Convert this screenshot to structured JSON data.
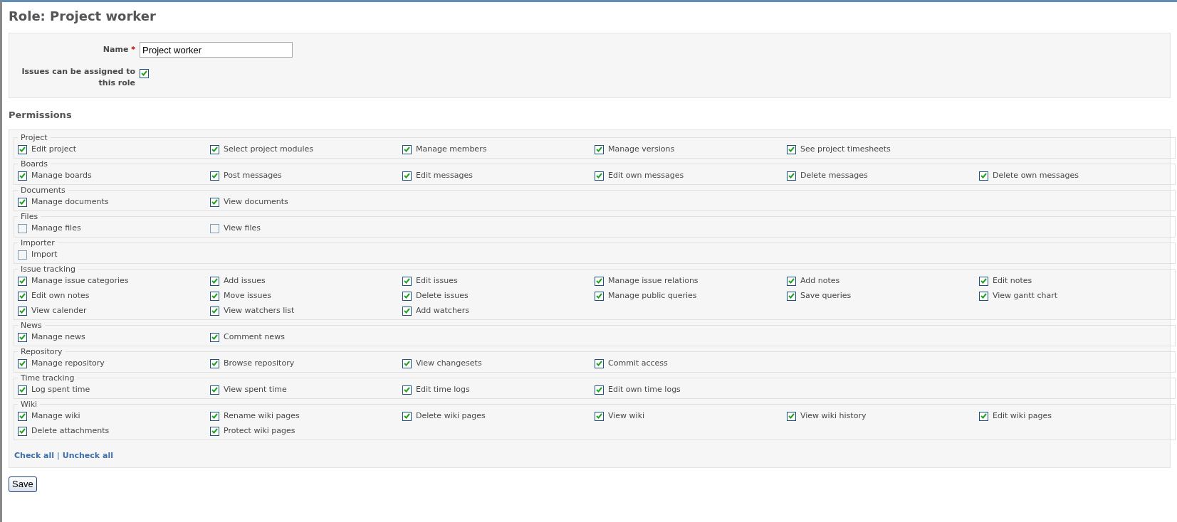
{
  "title": "Role: Project worker",
  "form": {
    "name_label": "Name",
    "required_mark": "*",
    "name_value": "Project worker",
    "assignable_label": "Issues can be assigned to this role",
    "assignable_checked": true
  },
  "permissions_heading": "Permissions",
  "groups": [
    {
      "legend": "Project",
      "items": [
        {
          "label": "Edit project",
          "checked": true
        },
        {
          "label": "Select project modules",
          "checked": true
        },
        {
          "label": "Manage members",
          "checked": true
        },
        {
          "label": "Manage versions",
          "checked": true
        },
        {
          "label": "See project timesheets",
          "checked": true
        }
      ]
    },
    {
      "legend": "Boards",
      "items": [
        {
          "label": "Manage boards",
          "checked": true
        },
        {
          "label": "Post messages",
          "checked": true
        },
        {
          "label": "Edit messages",
          "checked": true
        },
        {
          "label": "Edit own messages",
          "checked": true
        },
        {
          "label": "Delete messages",
          "checked": true
        },
        {
          "label": "Delete own messages",
          "checked": true
        }
      ]
    },
    {
      "legend": "Documents",
      "items": [
        {
          "label": "Manage documents",
          "checked": true
        },
        {
          "label": "View documents",
          "checked": true
        }
      ]
    },
    {
      "legend": "Files",
      "items": [
        {
          "label": "Manage files",
          "checked": false
        },
        {
          "label": "View files",
          "checked": false
        }
      ]
    },
    {
      "legend": "Importer",
      "items": [
        {
          "label": "Import",
          "checked": false
        }
      ]
    },
    {
      "legend": "Issue tracking",
      "items": [
        {
          "label": "Manage issue categories",
          "checked": true
        },
        {
          "label": "Add issues",
          "checked": true
        },
        {
          "label": "Edit issues",
          "checked": true
        },
        {
          "label": "Manage issue relations",
          "checked": true
        },
        {
          "label": "Add notes",
          "checked": true
        },
        {
          "label": "Edit notes",
          "checked": true
        },
        {
          "label": "Edit own notes",
          "checked": true
        },
        {
          "label": "Move issues",
          "checked": true
        },
        {
          "label": "Delete issues",
          "checked": true
        },
        {
          "label": "Manage public queries",
          "checked": true
        },
        {
          "label": "Save queries",
          "checked": true
        },
        {
          "label": "View gantt chart",
          "checked": true
        },
        {
          "label": "View calender",
          "checked": true
        },
        {
          "label": "View watchers list",
          "checked": true
        },
        {
          "label": "Add watchers",
          "checked": true
        }
      ]
    },
    {
      "legend": "News",
      "items": [
        {
          "label": "Manage news",
          "checked": true
        },
        {
          "label": "Comment news",
          "checked": true
        }
      ]
    },
    {
      "legend": "Repository",
      "items": [
        {
          "label": "Manage repository",
          "checked": true
        },
        {
          "label": "Browse repository",
          "checked": true
        },
        {
          "label": "View changesets",
          "checked": true
        },
        {
          "label": "Commit access",
          "checked": true
        }
      ]
    },
    {
      "legend": "Time tracking",
      "items": [
        {
          "label": "Log spent time",
          "checked": true
        },
        {
          "label": "View spent time",
          "checked": true
        },
        {
          "label": "Edit time logs",
          "checked": true
        },
        {
          "label": "Edit own time logs",
          "checked": true
        }
      ]
    },
    {
      "legend": "Wiki",
      "items": [
        {
          "label": "Manage wiki",
          "checked": true
        },
        {
          "label": "Rename wiki pages",
          "checked": true
        },
        {
          "label": "Delete wiki pages",
          "checked": true
        },
        {
          "label": "View wiki",
          "checked": true
        },
        {
          "label": "View wiki history",
          "checked": true
        },
        {
          "label": "Edit wiki pages",
          "checked": true
        },
        {
          "label": "Delete attachments",
          "checked": true
        },
        {
          "label": "Protect wiki pages",
          "checked": true
        }
      ]
    }
  ],
  "links": {
    "check_all": "Check all",
    "separator": "|",
    "uncheck_all": "Uncheck all"
  },
  "save_button": "Save"
}
